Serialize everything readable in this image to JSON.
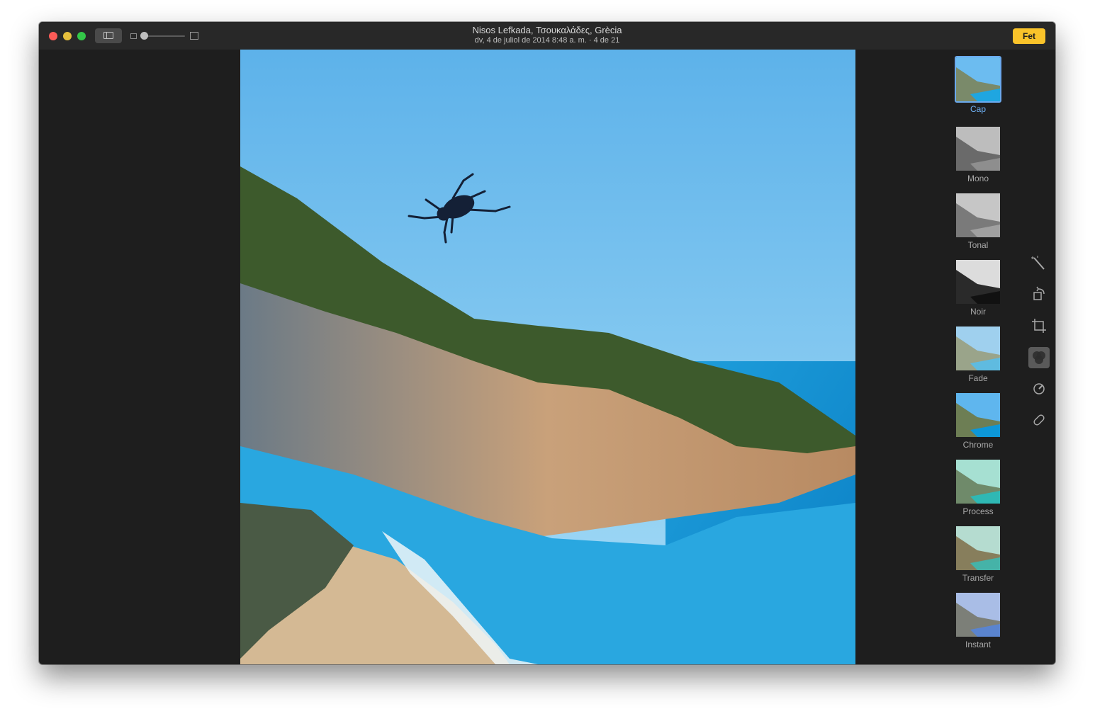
{
  "window": {
    "title": "Nisos Lefkada, Τσουκαλάδες, Grècia",
    "subtitle": "dv, 4 de juliol de 2014 8:48 a. m. · 4 de 21",
    "done_label": "Fet",
    "zoom_level": 0.0
  },
  "filters": [
    {
      "label": "Cap",
      "selected": true
    },
    {
      "label": "Mono",
      "selected": false
    },
    {
      "label": "Tonal",
      "selected": false
    },
    {
      "label": "Noir",
      "selected": false
    },
    {
      "label": "Fade",
      "selected": false
    },
    {
      "label": "Chrome",
      "selected": false
    },
    {
      "label": "Process",
      "selected": false
    },
    {
      "label": "Transfer",
      "selected": false
    },
    {
      "label": "Instant",
      "selected": false
    }
  ],
  "tools": [
    {
      "icon": "magic-wand-icon",
      "active": false
    },
    {
      "icon": "rotate-icon",
      "active": false
    },
    {
      "icon": "crop-icon",
      "active": false
    },
    {
      "icon": "filters-icon",
      "active": true
    },
    {
      "icon": "adjust-icon",
      "active": false
    },
    {
      "icon": "retouch-icon",
      "active": false
    }
  ],
  "colors": {
    "accent_done": "#f9c32a",
    "selection": "#6aa9ee"
  }
}
